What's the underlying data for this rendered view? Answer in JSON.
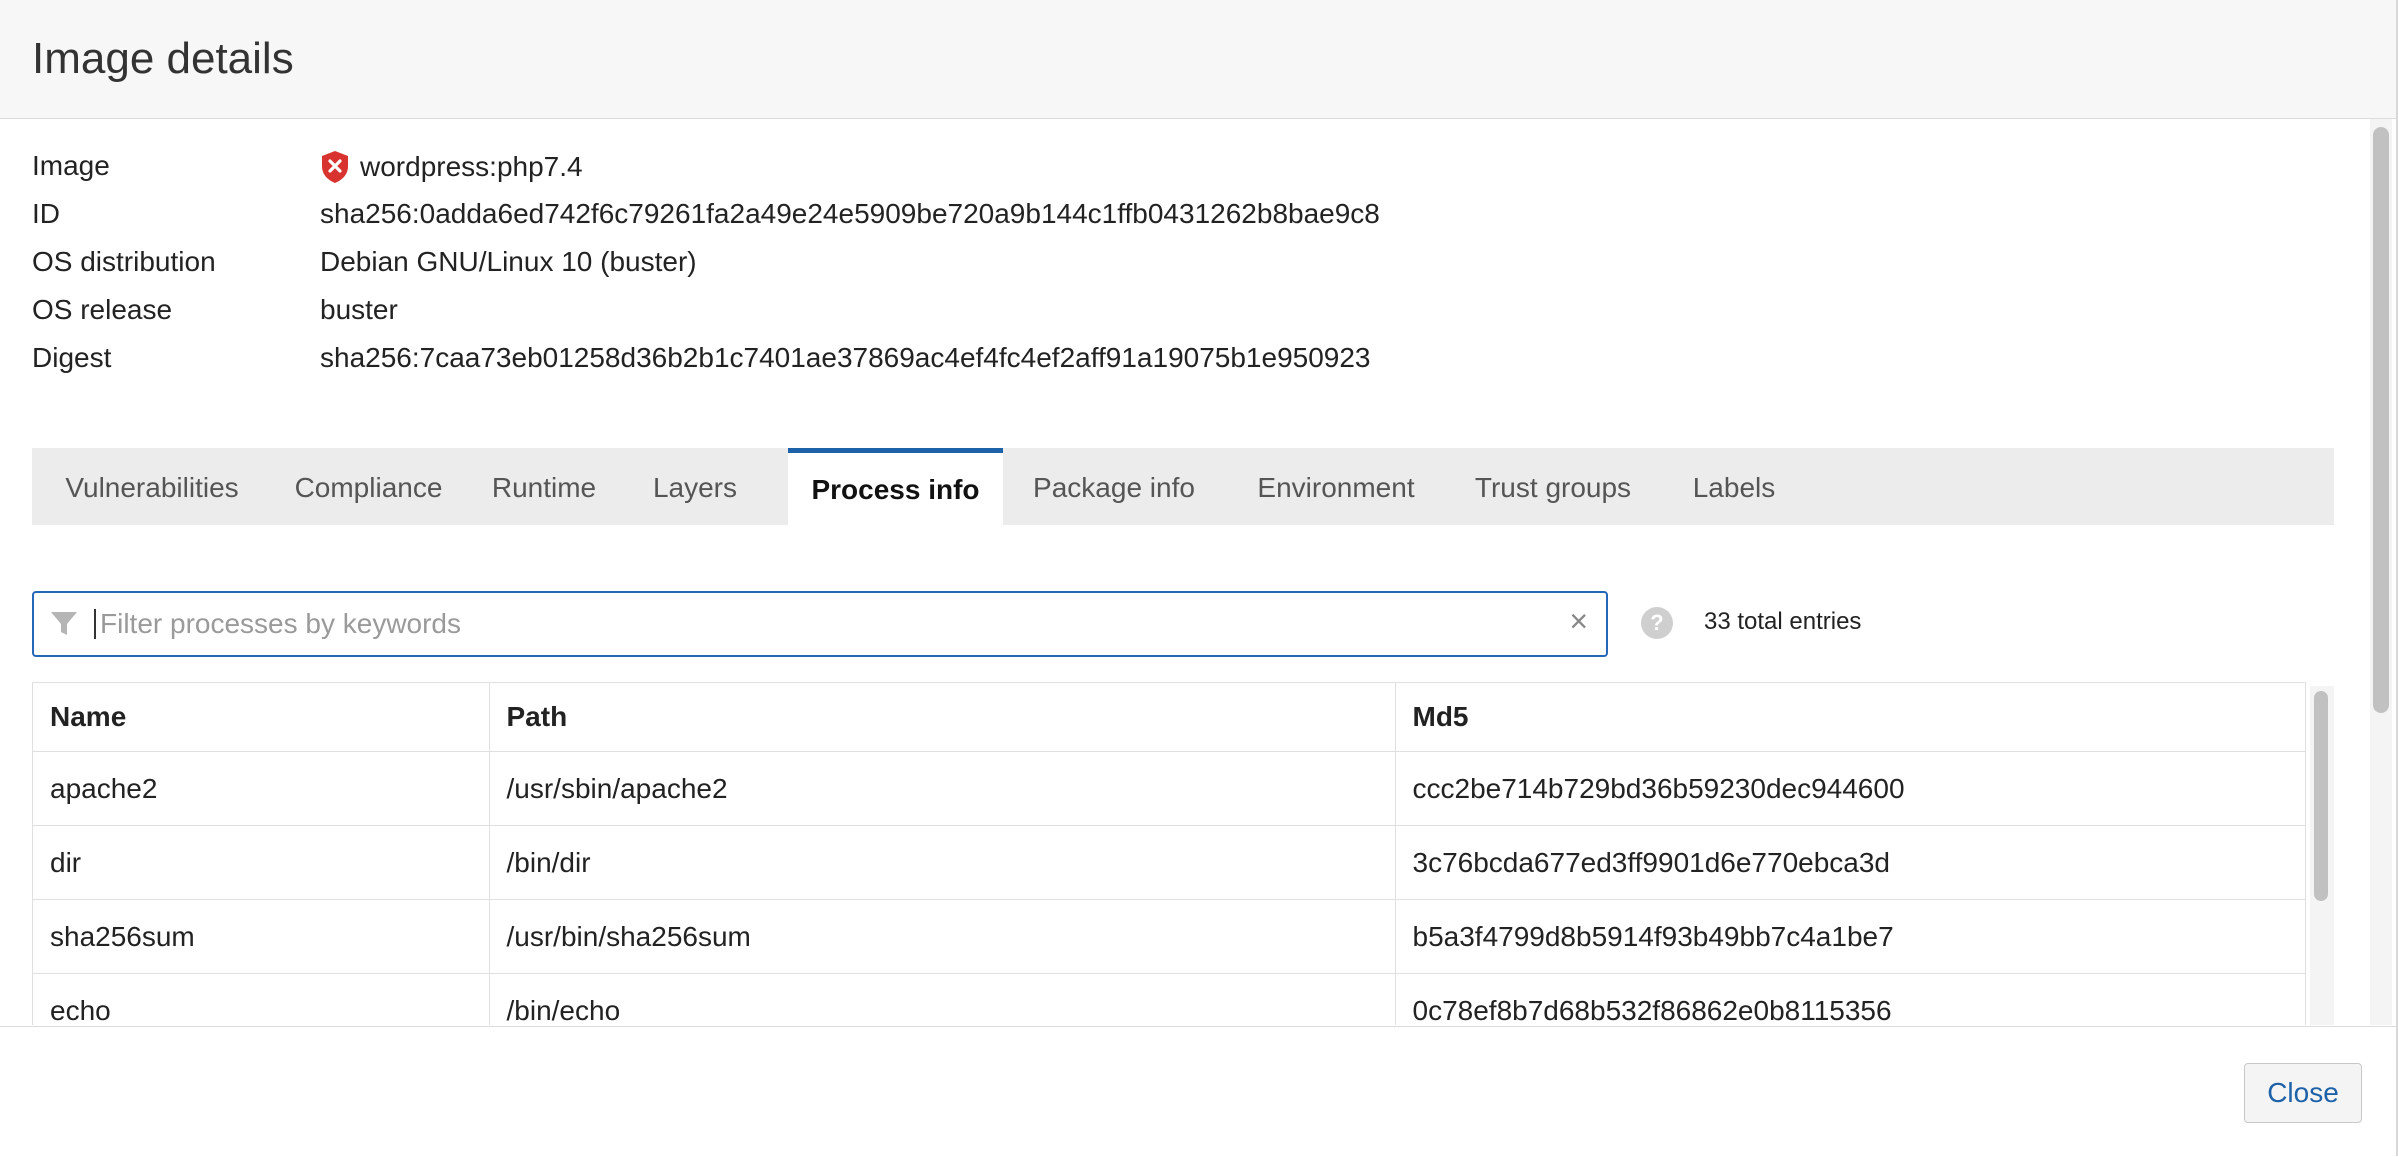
{
  "title": "Image details",
  "info": [
    {
      "label": "Image",
      "value": "wordpress:php7.4"
    },
    {
      "label": "ID",
      "value": "sha256:0adda6ed742f6c79261fa2a49e24e5909be720a9b144c1ffb0431262b8bae9c8"
    },
    {
      "label": "OS distribution",
      "value": "Debian GNU/Linux 10 (buster)"
    },
    {
      "label": "OS release",
      "value": "buster"
    },
    {
      "label": "Digest",
      "value": "sha256:7caa73eb01258d36b2b1c7401ae37869ac4ef4fc4ef2aff91a19075b1e950923"
    }
  ],
  "tabs": [
    "Vulnerabilities",
    "Compliance",
    "Runtime",
    "Layers",
    "Process info",
    "Package info",
    "Environment",
    "Trust groups",
    "Labels"
  ],
  "active_tab": "Process info",
  "filter": {
    "placeholder": "Filter processes by keywords",
    "value": ""
  },
  "total_entries": "33 total entries",
  "table": {
    "headers": [
      "Name",
      "Path",
      "Md5"
    ],
    "rows": [
      [
        "apache2",
        "/usr/sbin/apache2",
        "ccc2be714b729bd36b59230dec944600"
      ],
      [
        "dir",
        "/bin/dir",
        "3c76bcda677ed3ff9901d6e770ebca3d"
      ],
      [
        "sha256sum",
        "/usr/bin/sha256sum",
        "b5a3f4799d8b5914f93b49bb7c4a1be7"
      ],
      [
        "echo",
        "/bin/echo",
        "0c78ef8b7d68b532f86862e0b8115356"
      ]
    ]
  },
  "close_label": "Close",
  "colors": {
    "accent": "#1d62a8",
    "alert": "#d9332f"
  }
}
